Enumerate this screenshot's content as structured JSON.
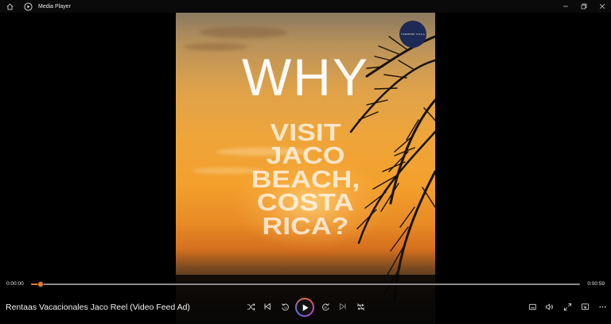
{
  "window": {
    "title": "Media Player",
    "controls": [
      "minimize",
      "restore",
      "close"
    ]
  },
  "video": {
    "headline": "WHY",
    "sub_lines": [
      "VISIT",
      "JACO",
      "BEACH,",
      "COSTA",
      "RICA?"
    ],
    "logo_text": "VERDEHE VILLA"
  },
  "playback": {
    "current_time": "0:00:00",
    "total_time": "0:00:59",
    "progress": 0.017,
    "media_title": "Rentaas Vacacionales Jaco Reel (Video Feed Ad)",
    "skip_back_seconds": "10",
    "skip_forward_seconds": "30"
  },
  "colors": {
    "accent": "#e67a2a"
  }
}
